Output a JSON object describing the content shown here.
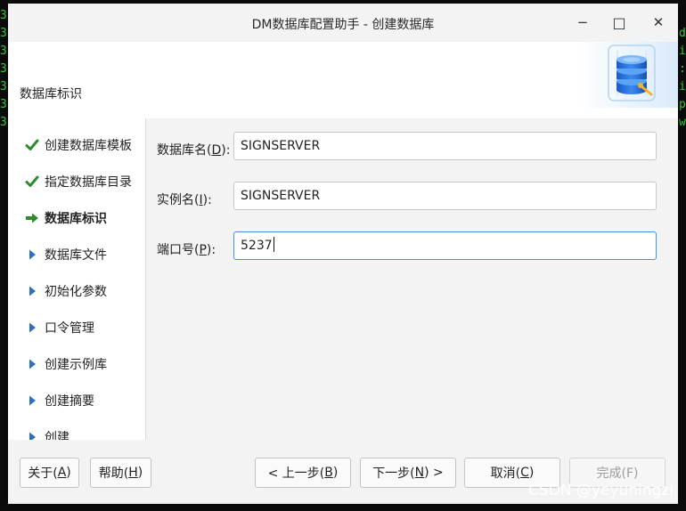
{
  "window": {
    "title": "DM数据库配置助手 - 创建数据库",
    "minimize": "−",
    "maximize": "□",
    "close": "✕"
  },
  "header": {
    "title": "数据库标识",
    "image_icon": "database-logo-icon"
  },
  "steps": [
    {
      "label": "创建数据库模板",
      "status": "done",
      "icon": "check-icon"
    },
    {
      "label": "指定数据库目录",
      "status": "done",
      "icon": "check-icon"
    },
    {
      "label": "数据库标识",
      "status": "current",
      "icon": "arrow-right-icon"
    },
    {
      "label": "数据库文件",
      "status": "pending",
      "icon": "triangle-right-icon"
    },
    {
      "label": "初始化参数",
      "status": "pending",
      "icon": "triangle-right-icon"
    },
    {
      "label": "口令管理",
      "status": "pending",
      "icon": "triangle-right-icon"
    },
    {
      "label": "创建示例库",
      "status": "pending",
      "icon": "triangle-right-icon"
    },
    {
      "label": "创建摘要",
      "status": "pending",
      "icon": "triangle-right-icon"
    },
    {
      "label": "创建",
      "status": "pending",
      "icon": "triangle-right-icon"
    }
  ],
  "form": {
    "db_name": {
      "label_pre": "数据库名(",
      "mnemonic": "D",
      "label_post": "):",
      "value": "SIGNSERVER"
    },
    "instance_name": {
      "label_pre": "实例名(",
      "mnemonic": "I",
      "label_post": "):",
      "value": "SIGNSERVER"
    },
    "port": {
      "label_pre": "端口号(",
      "mnemonic": "P",
      "label_post": "):",
      "value": "5237"
    }
  },
  "buttons": {
    "about": {
      "pre": "关于(",
      "mn": "A",
      "post": ")"
    },
    "help": {
      "pre": "帮助(",
      "mn": "H",
      "post": ")"
    },
    "prev": {
      "pre": "< 上一步(",
      "mn": "B",
      "post": ")"
    },
    "next": {
      "pre": "下一步(",
      "mn": "N",
      "post": ") >"
    },
    "cancel": {
      "pre": "取消(",
      "mn": "C",
      "post": ")"
    },
    "finish": {
      "label": "完成(F)"
    }
  },
  "watermark": "CSDN @yeyuningzi",
  "colors": {
    "check": "#2e8b2e",
    "arrow": "#2e8b2e",
    "triangle": "#2e6fc6",
    "focus_border": "#4a90e2",
    "terminal_text": "#33d033"
  }
}
